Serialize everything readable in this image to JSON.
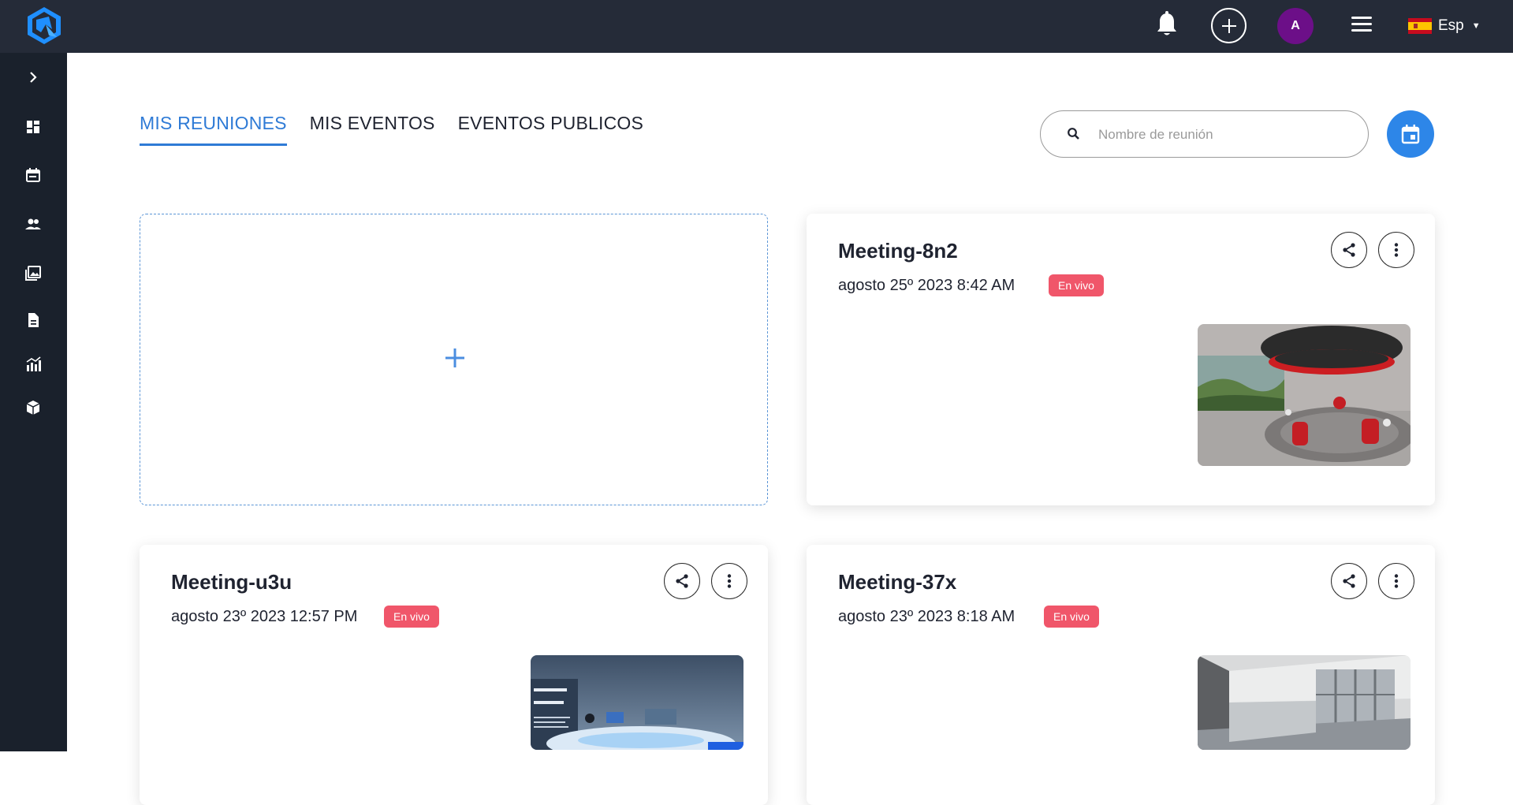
{
  "topbar": {
    "avatar_initial": "A",
    "language": "Esp"
  },
  "tabs": [
    {
      "label": "MIS REUNIONES",
      "active": true
    },
    {
      "label": "MIS EVENTOS",
      "active": false
    },
    {
      "label": "EVENTOS PUBLICOS",
      "active": false
    }
  ],
  "search": {
    "placeholder": "Nombre de reunión"
  },
  "meetings": [
    {
      "title": "Meeting-8n2",
      "date": "agosto 25º 2023 8:42 AM",
      "status": "En vivo"
    },
    {
      "title": "Meeting-u3u",
      "date": "agosto 23º 2023 12:57 PM",
      "status": "En vivo"
    },
    {
      "title": "Meeting-37x",
      "date": "agosto 23º 2023 8:18 AM",
      "status": "En vivo"
    }
  ],
  "colors": {
    "topbar": "#252b38",
    "sidebar": "#1a212c",
    "accent": "#2f7bd6",
    "badge": "#f0566a",
    "avatar": "#6c0f88"
  }
}
